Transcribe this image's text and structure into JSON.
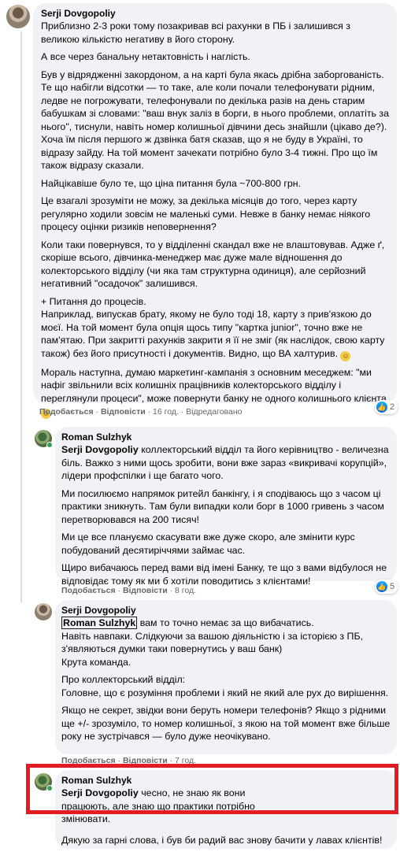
{
  "actions": {
    "like": "Подобається",
    "reply": "Відповісти",
    "edited": "Відредаговано"
  },
  "comments": [
    {
      "author": "Serji Dovgopoliy",
      "paragraphs": [
        "Приблизно 2-3 роки тому позакривав всі рахунки в ПБ і залишився з великою кількістю негативу в його сторону.",
        "А все через банальну нетактовність і наглість.",
        "Був у відрядженні закордоном, а на карті була якась дрібна заборгованість. Те що набігли відсотки — то таке, але коли почали телефонувати рідним, ледве не погрожувати, телефонували по декілька разів на день старим бабушкам зі словами: \"ваш внук заліз в борги, в нього проблеми, оплатіть за нього\", тиснули, навіть номер колишньої дівчини десь знайшли (цікаво де?). Хоча їм після першого ж дзвінка батя сказав, що я не буду в Україні, то відразу зайду. На той момент зачекати потрібно було 3-4 тижні. Про що їм також відразу сказали.",
        "Найцікавіше було те, що ціна питання була ~700-800 грн.",
        "Це взагалі зрозуміти не можу, за декілька місяців до того, через карту регулярно ходили зовсім не маленькі суми. Невже в банку немає ніякого процесу оцінки ризиків неповернення?",
        "Коли таки повернувся, то у відділенні скандал вже не влаштовував. Адже ґ, скоріше всього, дівчинка-менеджер має дуже мале відношення до колекторського відділу (чи яка там структурна одиниця), але серйозний негативний \"осадочок\" залишився.",
        "+ Питання до процесів.",
        "Наприклад, випускав брату, якому не було тоді 18, карту з прив'язкою до моєї. На той момент була опція щось типу \"картка junior\", точно вже не пам'ятаю. При закритті рахунків закрити я її не зміг (як наслідок, свою карту також) без його присутності і документів. Видно, що ВА халтурив.",
        "Мораль наступна, думаю маркетинг-кампанія з основним меседжем: \"ми нафіг звільнили всіх колишніх працівників колекторського відділу і переглянули процеси\", може повернути банку не одного колишнього клієнта"
      ],
      "time": "16 год.",
      "reactions": "2"
    },
    {
      "author": "Roman Sulzhyk",
      "mention": "Serji Dovgopoliy",
      "paragraphs": [
        "коллекторський відділ та його керівництво - величезна біль. Важко з ними щось зробити, вони вже зараз «викривачі корупцій», лідери профспілки і ще багато чого.",
        "Ми посилюємо напрямок ритейл банкінгу, і я сподіваюсь що з часом ці практики зникнуть. Там були випадки коли борг в 1000 гривень з часом перетворювався на 200 тисяч!",
        "Ми це все плануємо скасувати вже дуже скоро, але змінити курс побудований десятиріччями займає час.",
        "Щиро вибачаюсь перед вами від імені Банку, те що з вами відбулося не відповідає тому як ми б хотіли поводитись з клієнтами!"
      ],
      "time": "8 год.",
      "reactions": "5"
    },
    {
      "author": "Serji Dovgopoliy",
      "mention": "Roman Sulzhyk",
      "paragraphs": [
        "вам то точно немає за що вибачатись.",
        "Навіть навпаки. Слідкуючи за вашою діяльністю і за історією з ПБ, з'являються думки таки повернутись у ваш банк)",
        "Крута команда.",
        "Про коллекторський відділ:",
        "Головне, що є розуміння проблеми і який не який але рух до вирішення.",
        "Якщо не секрет, звідки вони беруть номери телефонів? Якщо з рідними ще +/- зрозуміло, то номер колишньої, з якою на той момент вже більше року не зустрічався — було дуже неочікувано."
      ],
      "time": "7 год."
    },
    {
      "author": "Roman Sulzhyk",
      "mention": "Serji Dovgopoliy",
      "paragraphs": [
        "чесно, не знаю як вони працюють, але знаю що практики потрібно змінювати.",
        "Дякую за гарні слова, і був би радий вас знову бачити у лавах клієнтів!"
      ]
    }
  ]
}
